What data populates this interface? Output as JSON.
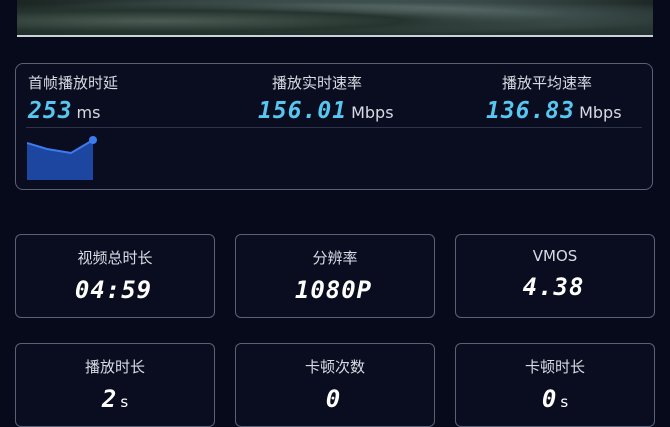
{
  "stats": {
    "first_frame_delay": {
      "label": "首帧播放时延",
      "value": "253",
      "unit": "ms"
    },
    "realtime_rate": {
      "label": "播放实时速率",
      "value": "156.01",
      "unit": "Mbps"
    },
    "average_rate": {
      "label": "播放平均速率",
      "value": "136.83",
      "unit": "Mbps"
    }
  },
  "colors": {
    "accent": "#57c6f0",
    "sparkline_fill": "#1f4aa8",
    "background": "#070a1a"
  },
  "cards": {
    "total_duration": {
      "label": "视频总时长",
      "value": "04:59",
      "unit": ""
    },
    "resolution": {
      "label": "分辨率",
      "value": "1080P",
      "unit": ""
    },
    "vmos": {
      "label": "VMOS",
      "value": "4.38",
      "unit": ""
    },
    "play_duration": {
      "label": "播放时长",
      "value": "2",
      "unit": "s"
    },
    "stall_count": {
      "label": "卡顿次数",
      "value": "0",
      "unit": ""
    },
    "stall_duration": {
      "label": "卡顿时长",
      "value": "0",
      "unit": "s"
    }
  }
}
